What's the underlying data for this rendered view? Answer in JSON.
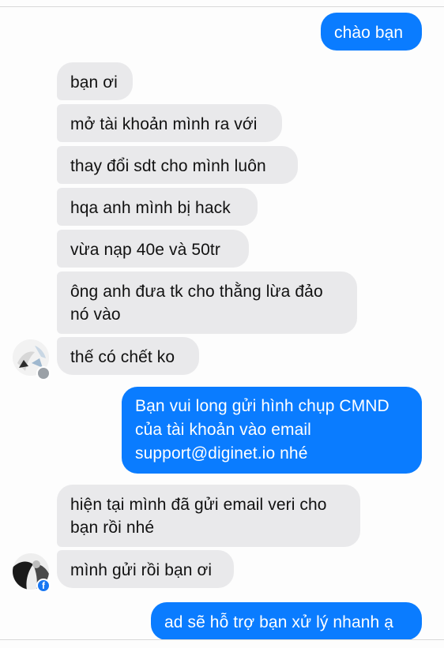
{
  "messages": {
    "outgoing": [
      "chào bạn",
      "Bạn vui long gửi hình chụp CMND của tài khoản vào email support@diginet.io nhé",
      "ad sẽ hỗ trợ bạn xử lý nhanh ạ"
    ],
    "incoming": [
      "bạn ơi",
      "mở tài khoản mình ra với",
      "thay đổi sdt cho mình luôn",
      "hqa anh mình bị hack",
      "vừa nạp 40e và 50tr",
      "ông anh đưa tk cho thằng lừa đảo nó vào",
      "thế có chết ko",
      "hiện tại mình đã gửi email veri cho bạn rồi nhé",
      "mình gửi rồi bạn ơi"
    ]
  },
  "avatars": [
    {
      "icon": "user-avatar-icon"
    },
    {
      "icon": "user-avatar-icon",
      "badge_icon": "facebook-icon",
      "badge_glyph": "f",
      "badge_color": "#1877f2"
    }
  ],
  "colors": {
    "outgoing_bubble": "#0a7cff",
    "incoming_bubble": "#e9e9eb"
  }
}
